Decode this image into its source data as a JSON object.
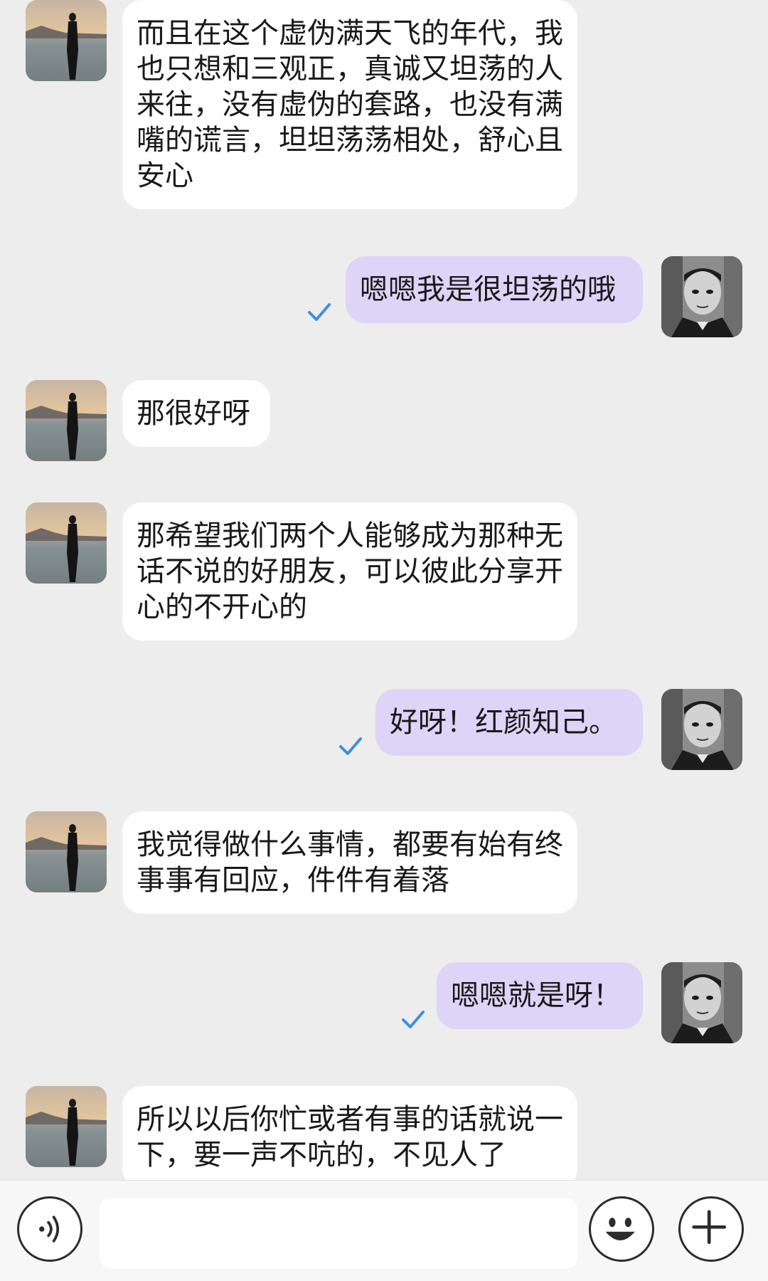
{
  "messages": [
    {
      "side": "in",
      "text": "而且在这个虚伪满天飞的年代，我也只想和三观正，真诚又坦荡的人来往，没有虚伪的套路，也没有满嘴的谎言，坦坦荡荡相处，舒心且安心"
    },
    {
      "side": "out",
      "text": "嗯嗯我是很坦荡的哦",
      "status": "read"
    },
    {
      "side": "in",
      "text": "那很好呀"
    },
    {
      "side": "in",
      "text": "那希望我们两个人能够成为那种无话不说的好朋友，可以彼此分享开心的不开心的"
    },
    {
      "side": "out",
      "text": "好呀！红颜知己。",
      "status": "read"
    },
    {
      "side": "in",
      "text": "我觉得做什么事情，都要有始有终  事事有回应，件件有着落"
    },
    {
      "side": "out",
      "text": "嗯嗯就是呀！",
      "status": "read"
    },
    {
      "side": "in",
      "text": "所以以后你忙或者有事的话就说一下，要一声不吭的，不见人了"
    }
  ],
  "input_bar": {
    "placeholder": "",
    "voice_icon": "voice-icon",
    "emoji_icon": "emoji-icon",
    "plus_icon": "plus-icon"
  },
  "colors": {
    "background": "#ededed",
    "incoming_bubble": "#ffffff",
    "outgoing_bubble": "#ddd4f7",
    "read_tick": "#3d8fe0"
  }
}
